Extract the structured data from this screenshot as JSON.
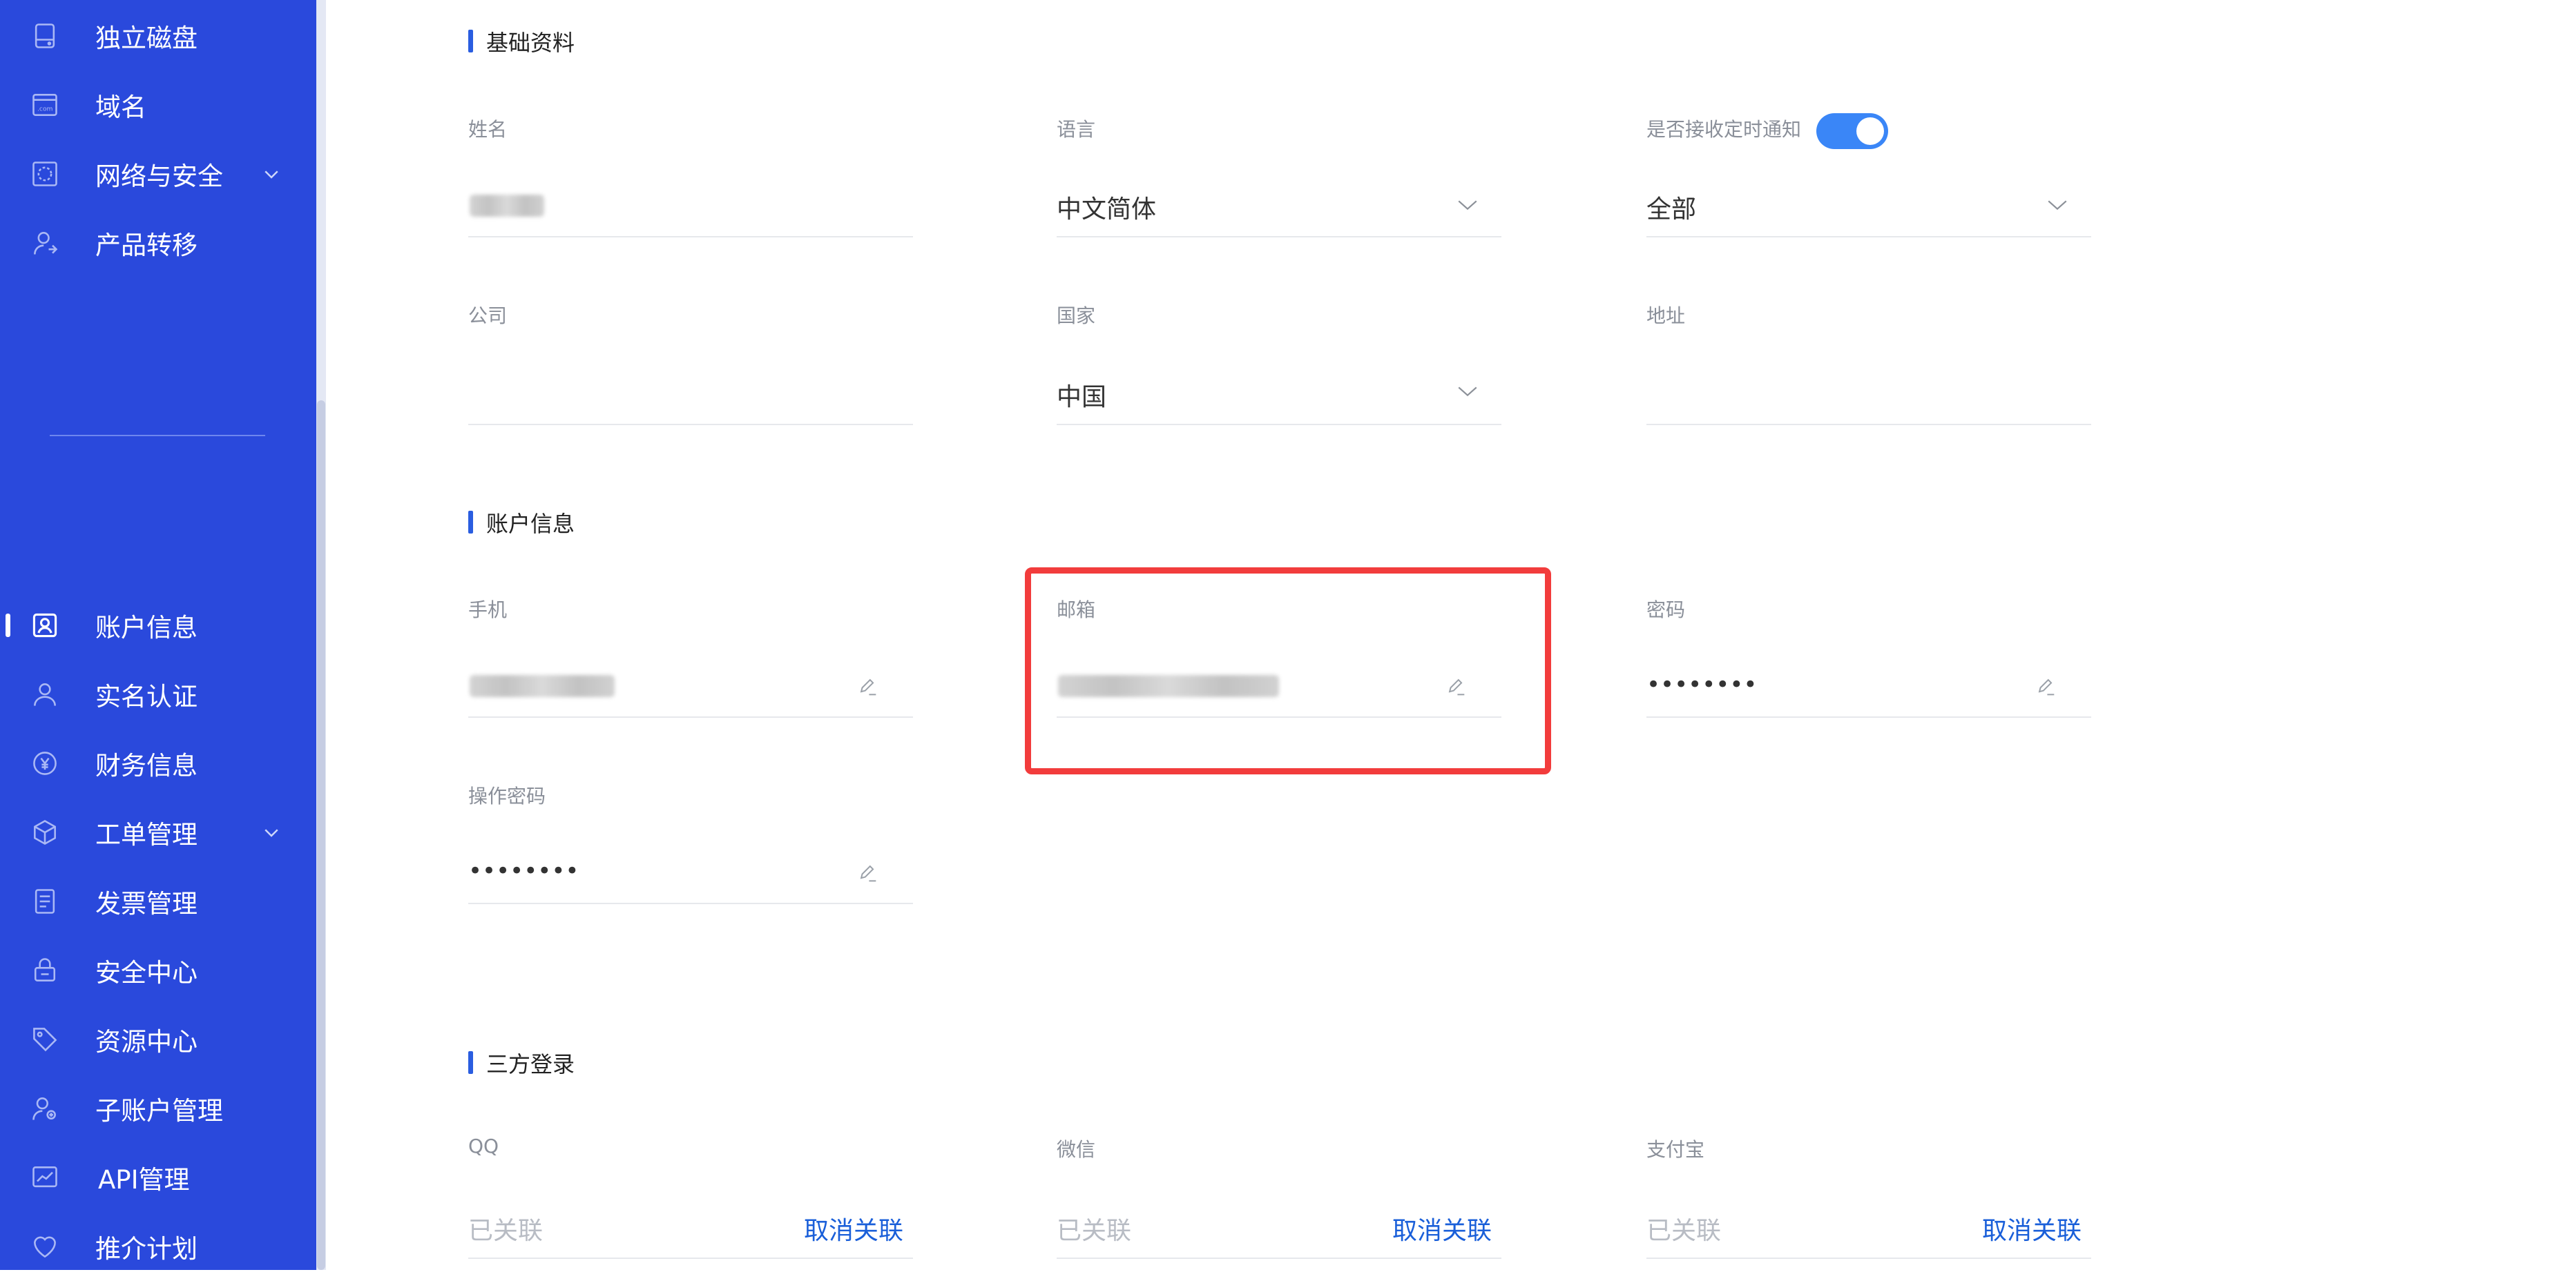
{
  "sidebar": {
    "items": [
      {
        "label": "独立磁盘",
        "icon": "disk-icon"
      },
      {
        "label": "域名",
        "icon": "domain-icon"
      },
      {
        "label": "网络与安全",
        "icon": "network-icon",
        "expandable": true
      },
      {
        "label": "产品转移",
        "icon": "user-transfer-icon"
      },
      {
        "label": "账户信息",
        "icon": "account-icon",
        "active": true
      },
      {
        "label": "实名认证",
        "icon": "verify-user-icon"
      },
      {
        "label": "财务信息",
        "icon": "finance-icon"
      },
      {
        "label": "工单管理",
        "icon": "ticket-box-icon",
        "expandable": true
      },
      {
        "label": "发票管理",
        "icon": "invoice-icon"
      },
      {
        "label": "安全中心",
        "icon": "lock-icon"
      },
      {
        "label": "资源中心",
        "icon": "tag-icon"
      },
      {
        "label": "子账户管理",
        "icon": "sub-account-icon"
      },
      {
        "label": "API管理",
        "icon": "api-chart-icon"
      },
      {
        "label": "推介计划",
        "icon": "heart-icon"
      }
    ]
  },
  "basic": {
    "title": "基础资料",
    "name_label": "姓名",
    "language_label": "语言",
    "language_value": "中文简体",
    "notify_label": "是否接收定时通知",
    "notify_value": "全部",
    "company_label": "公司",
    "country_label": "国家",
    "country_value": "中国",
    "address_label": "地址"
  },
  "account": {
    "title": "账户信息",
    "phone_label": "手机",
    "email_label": "邮箱",
    "password_label": "密码",
    "password_value": "••••••••",
    "op_password_label": "操作密码",
    "op_password_value": "••••••••"
  },
  "third_party": {
    "title": "三方登录",
    "items": [
      {
        "label": "QQ",
        "status": "已关联",
        "action": "取消关联"
      },
      {
        "label": "微信",
        "status": "已关联",
        "action": "取消关联"
      },
      {
        "label": "支付宝",
        "status": "已关联",
        "action": "取消关联"
      }
    ]
  },
  "colors": {
    "sidebar_bg": "#2a49dc",
    "accent": "#2a5de0",
    "link": "#1a5fd9",
    "toggle_on": "#3a86f7",
    "highlight": "#f23c3c"
  }
}
